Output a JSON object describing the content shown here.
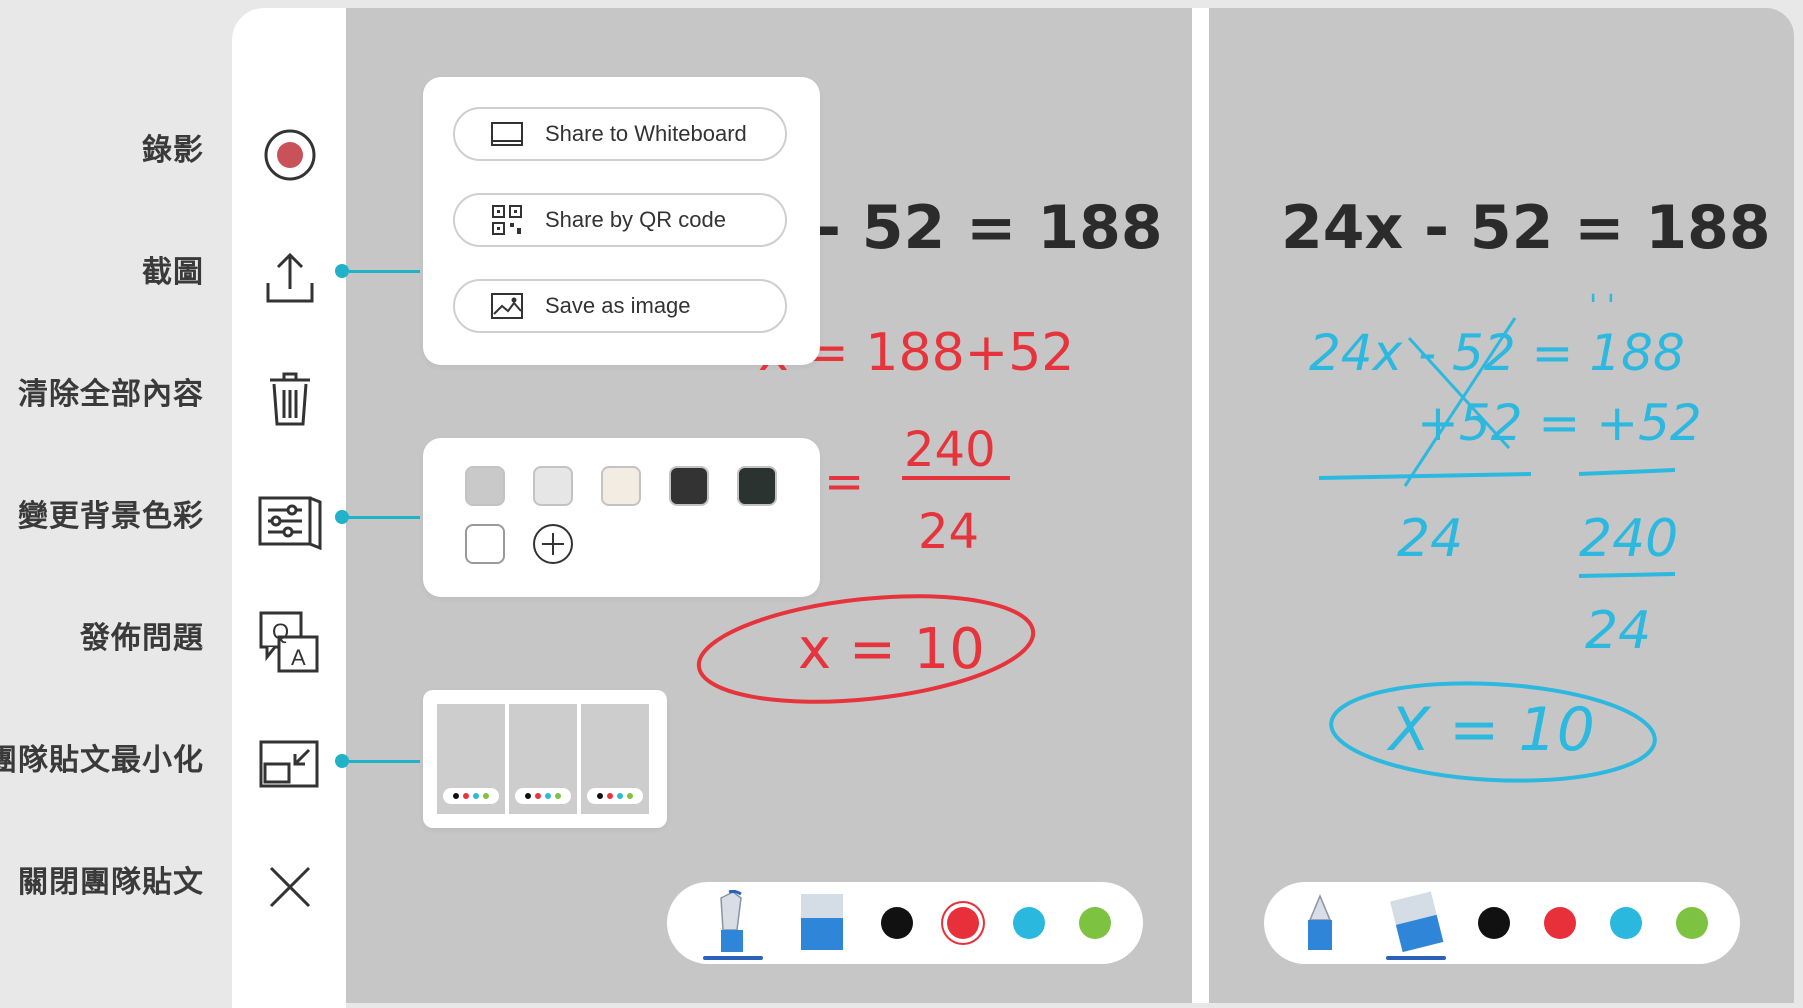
{
  "sidebar_labels": {
    "record": "錄影",
    "screenshot": "截圖",
    "clear_all": "清除全部內容",
    "change_bg": "變更背景色彩",
    "post_question": "發佈問題",
    "minimize": "團隊貼文最小化",
    "close": "關閉團隊貼文"
  },
  "share_menu": {
    "whiteboard": "Share to Whiteboard",
    "qr": "Share by QR code",
    "save_image": "Save as image"
  },
  "qa_icon": {
    "q": "Q",
    "a": "A"
  },
  "background_swatches": [
    "#c9c9c9",
    "#e6e6e6",
    "#f3ece2",
    "#333333",
    "#2a3330",
    "#ffffff"
  ],
  "layout_preview": {
    "count": 3,
    "dot_colors": [
      "#111111",
      "#e6343c",
      "#2cb8df",
      "#7dc241"
    ]
  },
  "left_board": {
    "line1": "- 52 = 188",
    "line2a": "x = 188+52",
    "line3_eq": "=",
    "line3_num": "240",
    "line3_den": "24",
    "answer": "x = 10"
  },
  "right_board": {
    "line1": "24x - 52 = 188",
    "ticks": "' '",
    "eq1": "24x - 52 = 188",
    "eq2": "+52 = +52",
    "den_left": "24",
    "num_right": "240",
    "den_right": "24",
    "answer": "X = 10"
  },
  "pen_colors": [
    "#111111",
    "#e8303a",
    "#2bb8df",
    "#7dc241"
  ],
  "left_selected_color": "#e8303a",
  "left_selected_tool": "pen",
  "right_selected_tool": "eraser"
}
